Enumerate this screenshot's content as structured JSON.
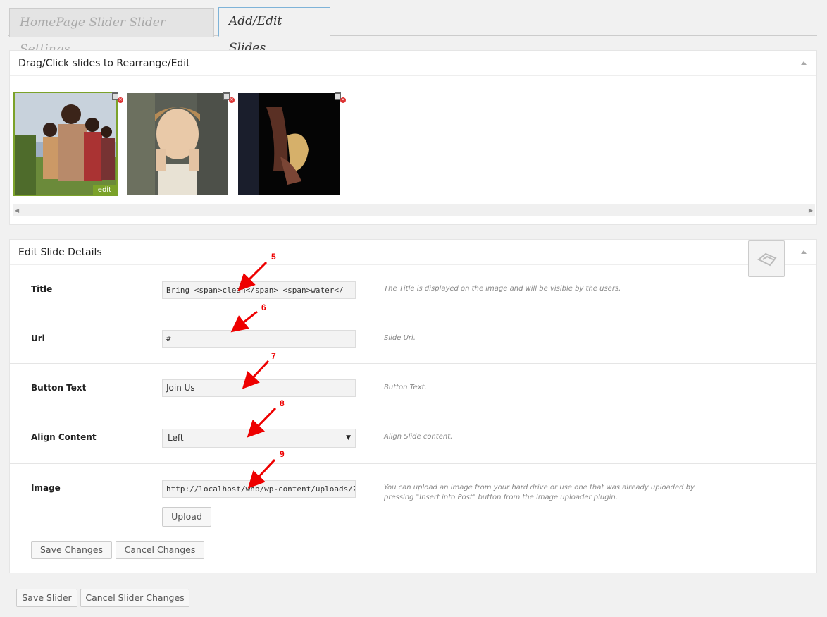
{
  "tabs": [
    {
      "label": "HomePage Slider Slider Settings"
    },
    {
      "label": "Add/Edit Slides"
    }
  ],
  "slides_box": {
    "heading": "Drag/Click slides to Rearrange/Edit",
    "edit_label": "edit"
  },
  "details_box": {
    "heading": "Edit Slide Details",
    "fields": {
      "title": {
        "label": "Title",
        "value": "Bring <span>clean</span> <span>water</",
        "desc": "The Title is displayed on the image and will be visible by the users."
      },
      "url": {
        "label": "Url",
        "value": "#",
        "desc": "Slide Url."
      },
      "button_text": {
        "label": "Button Text",
        "value": "Join Us",
        "desc": "Button Text."
      },
      "align": {
        "label": "Align Content",
        "value": "Left",
        "desc": "Align Slide content."
      },
      "image": {
        "label": "Image",
        "value": "http://localhost/whb/wp-content/uploads/2",
        "desc": "You can upload an image from your hard drive or use one that was already uploaded by pressing \"Insert into Post\" button from the image uploader plugin."
      }
    },
    "upload_label": "Upload",
    "save_changes": "Save Changes",
    "cancel_changes": "Cancel Changes"
  },
  "footer": {
    "save_slider": "Save Slider",
    "cancel_slider": "Cancel Slider Changes"
  },
  "annotations": [
    "5",
    "6",
    "7",
    "8",
    "9"
  ],
  "colors": {
    "accent": "#7ba22a",
    "arrow": "#e00000"
  }
}
